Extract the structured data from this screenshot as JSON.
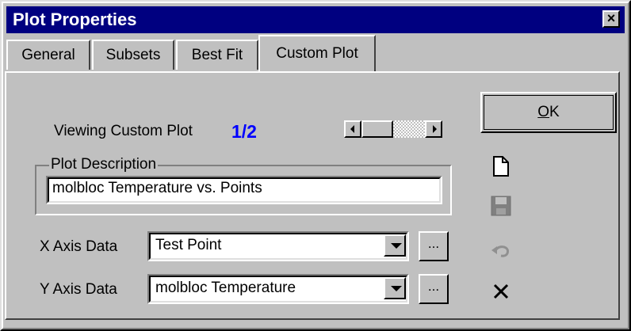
{
  "window": {
    "title": "Plot Properties",
    "close_glyph": "×"
  },
  "tabs": [
    {
      "label": "General"
    },
    {
      "label": "Subsets"
    },
    {
      "label": "Best Fit"
    },
    {
      "label": "Custom Plot",
      "active": true
    }
  ],
  "viewing": {
    "label": "Viewing Custom Plot",
    "value": "1/2",
    "value_color": "#0000ff"
  },
  "plot_description": {
    "legend": "Plot Description",
    "value": "molbloc Temperature vs. Points"
  },
  "x_axis": {
    "label": "X Axis Data",
    "value": "Test Point",
    "more_label": "..."
  },
  "y_axis": {
    "label": "Y Axis Data",
    "value": "molbloc Temperature",
    "more_label": "..."
  },
  "ok_button": {
    "label": "OK",
    "mnemonic": "O"
  },
  "icons": [
    "new-file-icon",
    "save-icon",
    "undo-icon",
    "delete-icon"
  ],
  "colors": {
    "titlebar": "#000080",
    "face": "#c0c0c0"
  }
}
